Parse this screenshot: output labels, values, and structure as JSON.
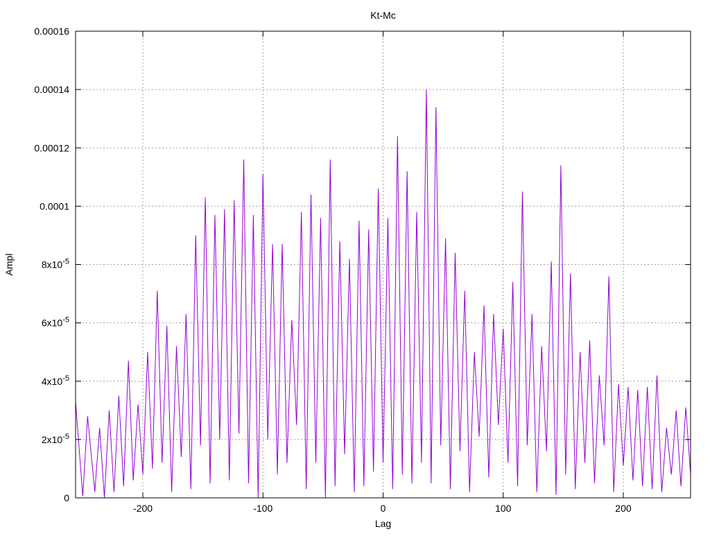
{
  "chart_data": {
    "type": "line",
    "title": "Kt-Mc",
    "xlabel": "Lag",
    "ylabel": "Ampl",
    "xlim": [
      -256,
      256
    ],
    "ylim": [
      0,
      0.00016
    ],
    "grid": true,
    "series_color": "#9400d3",
    "x_ticks": [
      {
        "value": -200,
        "label": "-200"
      },
      {
        "value": -100,
        "label": "-100"
      },
      {
        "value": 0,
        "label": "0"
      },
      {
        "value": 100,
        "label": "100"
      },
      {
        "value": 200,
        "label": "200"
      }
    ],
    "y_ticks": [
      {
        "value": 0,
        "mant": "0",
        "exp": ""
      },
      {
        "value": 2e-05,
        "mant": "2x10",
        "exp": "-5"
      },
      {
        "value": 4e-05,
        "mant": "4x10",
        "exp": "-5"
      },
      {
        "value": 6e-05,
        "mant": "6x10",
        "exp": "-5"
      },
      {
        "value": 8e-05,
        "mant": "8x10",
        "exp": "-5"
      },
      {
        "value": 0.0001,
        "mant": "0.0001",
        "exp": ""
      },
      {
        "value": 0.00012,
        "mant": "0.00012",
        "exp": ""
      },
      {
        "value": 0.00014,
        "mant": "0.00014",
        "exp": ""
      },
      {
        "value": 0.00016,
        "mant": "0.00016",
        "exp": ""
      }
    ],
    "series": [
      {
        "x": [
          -256,
          -250,
          -246,
          -240,
          -236,
          -232,
          -228,
          -224,
          -220,
          -216,
          -212,
          -208,
          -204,
          -200,
          -196,
          -192,
          -188,
          -184,
          -180,
          -176,
          -172,
          -168,
          -164,
          -160,
          -156,
          -152,
          -148,
          -144,
          -140,
          -136,
          -132,
          -128,
          -124,
          -120,
          -116,
          -112,
          -108,
          -104,
          -100,
          -96,
          -92,
          -88,
          -84,
          -80,
          -76,
          -72,
          -68,
          -64,
          -60,
          -56,
          -52,
          -48,
          -44,
          -40,
          -36,
          -32,
          -28,
          -24,
          -20,
          -16,
          -12,
          -8,
          -4,
          0,
          4,
          8,
          12,
          16,
          20,
          24,
          28,
          32,
          36,
          40,
          44,
          48,
          52,
          56,
          60,
          64,
          68,
          72,
          76,
          80,
          84,
          88,
          92,
          96,
          100,
          104,
          108,
          112,
          116,
          120,
          124,
          128,
          132,
          136,
          140,
          144,
          148,
          152,
          156,
          160,
          164,
          168,
          172,
          176,
          180,
          184,
          188,
          192,
          196,
          200,
          204,
          208,
          212,
          216,
          220,
          224,
          228,
          232,
          236,
          240,
          244,
          248,
          252,
          256
        ],
        "y": [
          3.3e-05,
          5e-07,
          2.8e-05,
          2e-06,
          2.4e-05,
          0.0,
          3e-05,
          2e-06,
          3.5e-05,
          4e-06,
          4.7e-05,
          6e-06,
          3.2e-05,
          8e-06,
          5e-05,
          1e-05,
          7.1e-05,
          1.2e-05,
          5.9e-05,
          2e-06,
          5.2e-05,
          1.4e-05,
          6.3e-05,
          3e-06,
          9e-05,
          1.8e-05,
          0.000103,
          5e-06,
          9.7e-05,
          2e-05,
          9.9e-05,
          6e-06,
          0.000102,
          2.2e-05,
          0.000116,
          5e-06,
          9.7e-05,
          0.0,
          0.000111,
          2e-05,
          8.7e-05,
          8e-06,
          8.7e-05,
          1.2e-05,
          6.1e-05,
          2.5e-05,
          9.8e-05,
          3e-06,
          0.000104,
          1.2e-05,
          9.6e-05,
          0.0,
          0.000116,
          4e-06,
          8.8e-05,
          1.5e-05,
          8.2e-05,
          2e-06,
          9.5e-05,
          4e-06,
          9.2e-05,
          9e-06,
          0.000106,
          1.2e-05,
          9.6e-05,
          3e-06,
          0.000124,
          8e-06,
          0.000112,
          5e-06,
          9.8e-05,
          1.2e-05,
          0.00014,
          5e-06,
          0.000134,
          1.8e-05,
          8.9e-05,
          3e-06,
          8.4e-05,
          1.6e-05,
          7.1e-05,
          2e-06,
          5e-05,
          2.1e-05,
          6.6e-05,
          7e-06,
          6.3e-05,
          2.5e-05,
          5.8e-05,
          1.2e-05,
          7.4e-05,
          4e-06,
          0.000105,
          1.8e-05,
          6.3e-05,
          2e-06,
          5.2e-05,
          1.6e-05,
          8.1e-05,
          1e-06,
          0.000114,
          8e-06,
          7.7e-05,
          3e-06,
          5e-05,
          1.2e-05,
          5.4e-05,
          5e-06,
          4.2e-05,
          1.8e-05,
          7.6e-05,
          2e-06,
          3.9e-05,
          1.1e-05,
          3.8e-05,
          6e-06,
          3.7e-05,
          4e-06,
          3.8e-05,
          3e-06,
          4.2e-05,
          2e-06,
          2.4e-05,
          8e-06,
          3e-05,
          4e-06,
          3.1e-05,
          8e-06
        ]
      }
    ]
  }
}
